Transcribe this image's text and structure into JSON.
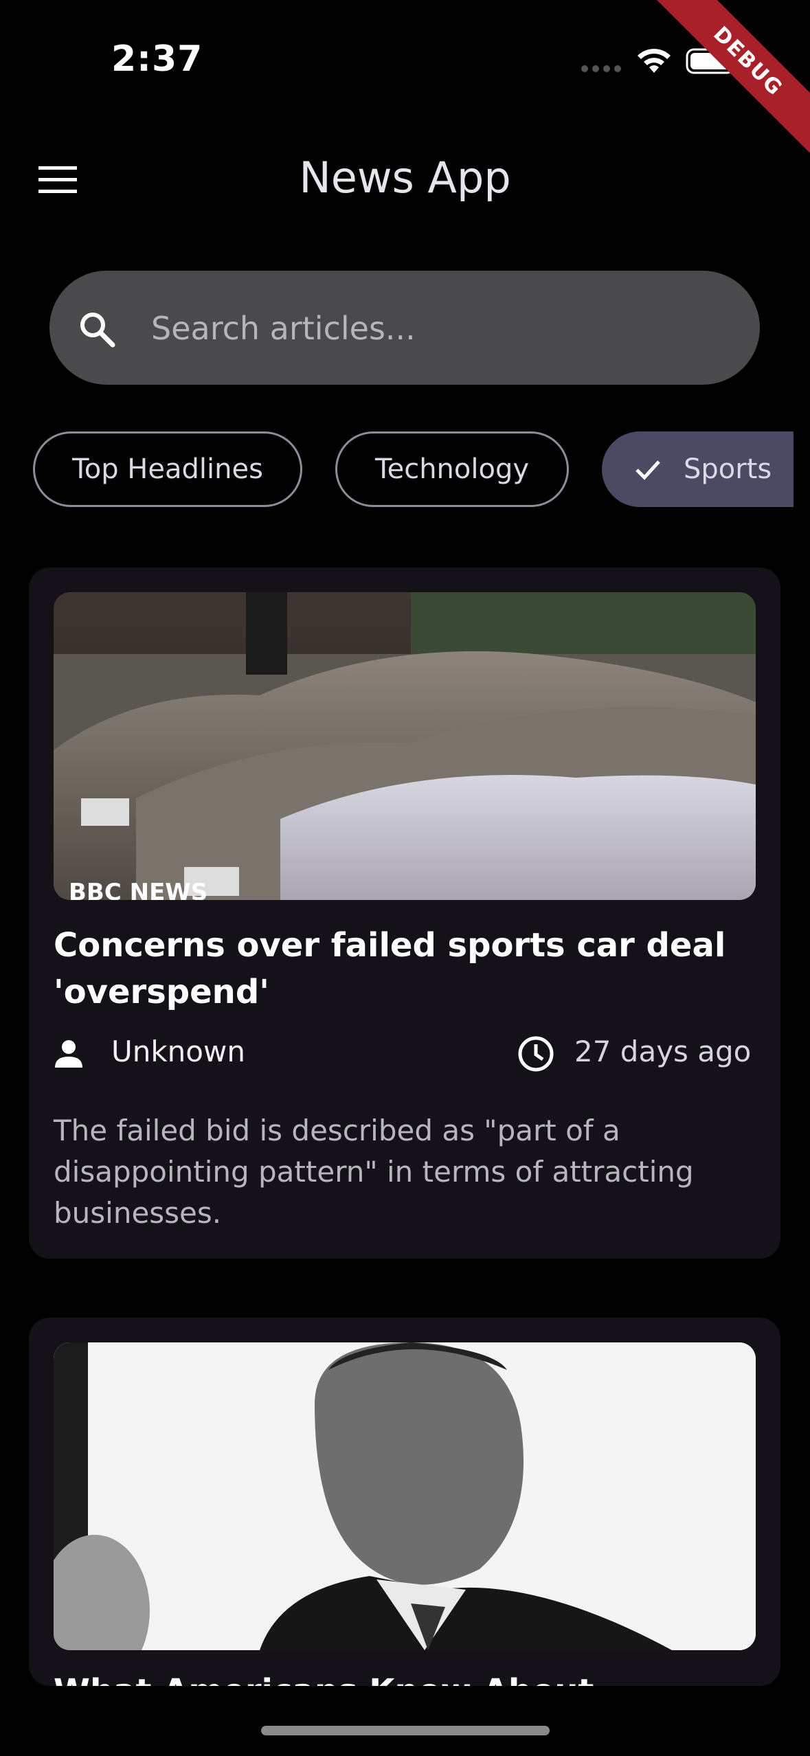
{
  "status_bar": {
    "time": "2:37"
  },
  "debug_banner": {
    "label": "DEBUG"
  },
  "app_bar": {
    "title": "News App"
  },
  "search": {
    "placeholder": "Search articles..."
  },
  "chips": [
    {
      "label": "Top Headlines",
      "selected": false
    },
    {
      "label": "Technology",
      "selected": false
    },
    {
      "label": "Sports",
      "selected": true
    }
  ],
  "articles": [
    {
      "image_watermark": "BBC NEWS",
      "title": "Concerns over failed sports car deal 'overspend'",
      "author": "Unknown",
      "time_ago": "27 days ago",
      "description": "The failed bid is described as \"part of a disappointing pattern\" in terms of attracting businesses."
    },
    {
      "title": "What Americans Know About Climate"
    }
  ],
  "colors": {
    "background": "#000000",
    "card": "#141218",
    "search_bg": "#4a4a4c",
    "chip_selected": "#4b4a63",
    "chip_border": "#8f8c99",
    "debug_banner": "#a8202a"
  },
  "icons": [
    "menu-icon",
    "search-icon",
    "check-icon",
    "person-icon",
    "clock-icon",
    "wifi-icon",
    "battery-icon"
  ]
}
